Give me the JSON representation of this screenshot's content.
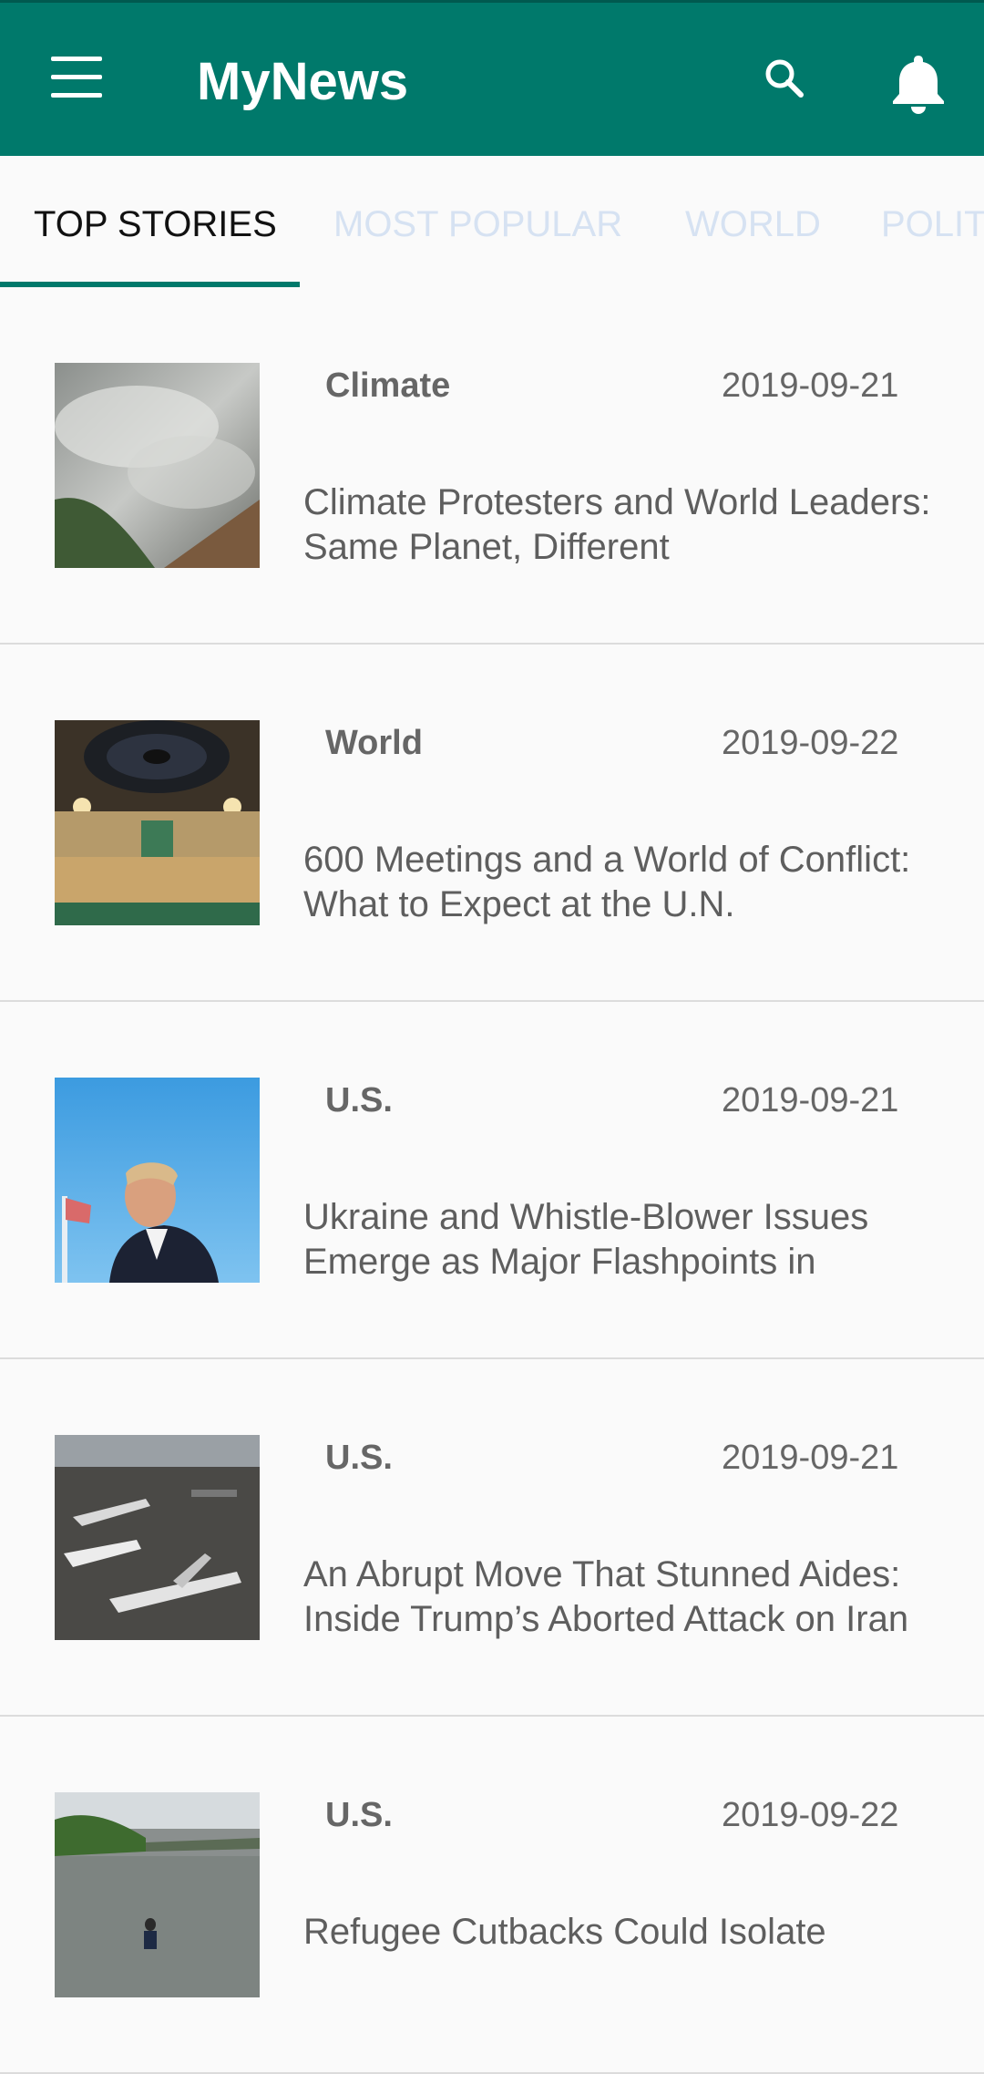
{
  "app": {
    "title": "MyNews"
  },
  "toolbar": {
    "menu_icon": "menu-icon",
    "search_icon": "search-icon",
    "notifications_icon": "bell-icon",
    "color": "#00796b"
  },
  "tabs": [
    {
      "label": "TOP STORIES",
      "active": true
    },
    {
      "label": "MOST POPULAR",
      "active": false
    },
    {
      "label": "WORLD",
      "active": false
    },
    {
      "label": "POLIT",
      "active": false
    }
  ],
  "articles": [
    {
      "category": "Climate",
      "date": "2019-09-21",
      "headline": "Climate Protesters and World Leaders: Same Planet, Different",
      "image": "smoke-forest-photo"
    },
    {
      "category": "World",
      "date": "2019-09-22",
      "headline": "600 Meetings and a World of Conflict: What to Expect at the U.N.",
      "image": "un-assembly-hall-photo"
    },
    {
      "category": "U.S.",
      "date": "2019-09-21",
      "headline": "Ukraine and Whistle-Blower Issues Emerge as Major Flashpoints in",
      "image": "trump-profile-photo"
    },
    {
      "category": "U.S.",
      "date": "2019-09-21",
      "headline": "An Abrupt Move That Stunned Aides: Inside Trump’s Aborted Attack on Iran",
      "image": "aircraft-carrier-photo"
    },
    {
      "category": "U.S.",
      "date": "2019-09-22",
      "headline": "Refugee Cutbacks Could Isolate",
      "image": "person-in-river-photo"
    }
  ]
}
